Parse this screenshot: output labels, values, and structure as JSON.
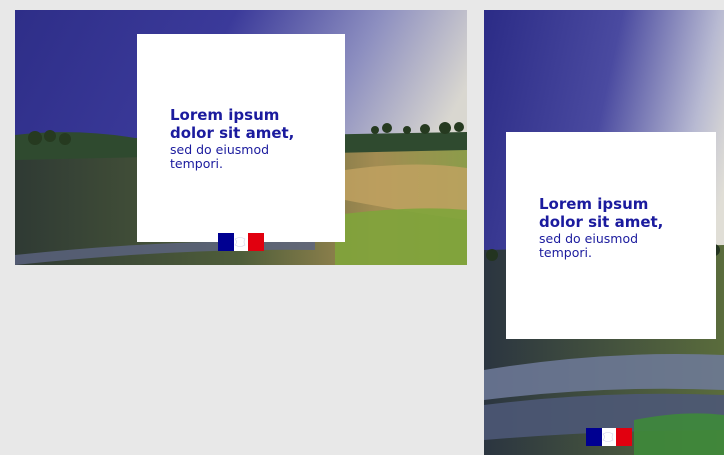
{
  "cards": [
    {
      "id": "landscape",
      "headline_line1": "Lorem ipsum",
      "headline_line2": "dolor sit amet,",
      "sub_line1": "sed do eiusmod",
      "sub_line2": "tempori."
    },
    {
      "id": "portrait",
      "headline_line1": "Lorem ipsum",
      "headline_line2": "dolor sit amet,",
      "sub_line1": "sed do eiusmod",
      "sub_line2": "tempori."
    }
  ],
  "colors": {
    "headline": "#1b1b9e",
    "page_background": "#e8e8e8",
    "flag_blue": "#000091",
    "flag_red": "#e1000f"
  },
  "icons": [
    "marianne-flag-logo"
  ]
}
